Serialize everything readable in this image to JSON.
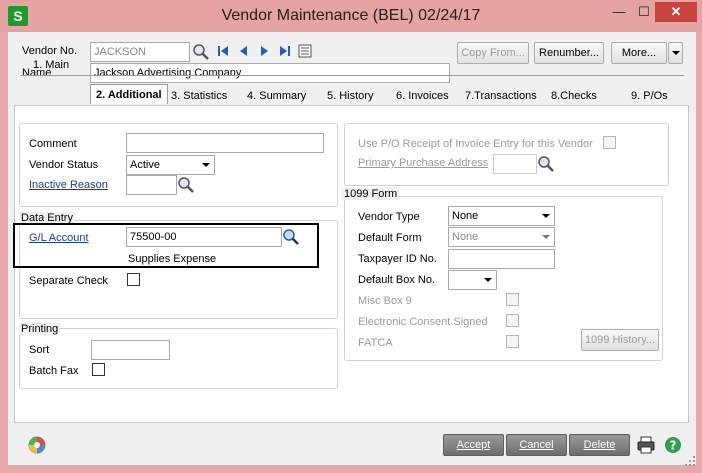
{
  "window": {
    "title": "Vendor Maintenance (BEL) 02/24/17",
    "app_icon_letter": "S",
    "minimize": "—",
    "maximize": "☐",
    "close": "✕"
  },
  "header": {
    "vendor_no_label": "Vendor No.",
    "vendor_no_value": "JACKSON",
    "name_label": "Name",
    "name_value": "Jackson Advertising Company",
    "copy_from": "Copy From...",
    "renumber": "Renumber...",
    "more": "More..."
  },
  "tabs": [
    {
      "label": "1. Main"
    },
    {
      "label": "2. Additional"
    },
    {
      "label": "3. Statistics"
    },
    {
      "label": "4. Summary"
    },
    {
      "label": "5. History"
    },
    {
      "label": "6. Invoices"
    },
    {
      "label": "7.Transactions"
    },
    {
      "label": "8.Checks"
    },
    {
      "label": "9. P/Os"
    }
  ],
  "general": {
    "comment_label": "Comment",
    "comment_value": "",
    "vendor_status_label": "Vendor Status",
    "vendor_status_value": "Active",
    "inactive_reason_label": "Inactive Reason",
    "inactive_reason_value": ""
  },
  "data_entry": {
    "title": "Data Entry",
    "gl_account_label": "G/L Account",
    "gl_account_value": "75500-00",
    "gl_account_desc": "Supplies Expense",
    "separate_check_label": "Separate Check"
  },
  "printing": {
    "title": "Printing",
    "sort_label": "Sort",
    "sort_value": "",
    "batch_fax_label": "Batch Fax"
  },
  "po": {
    "use_po_receipt_label": "Use P/O Receipt of Invoice Entry for this Vendor",
    "primary_purchase_label": "Primary Purchase Address"
  },
  "form1099": {
    "title": "1099 Form",
    "vendor_type_label": "Vendor Type",
    "vendor_type_value": "None",
    "default_form_label": "Default Form",
    "default_form_value": "None",
    "taxpayer_id_label": "Taxpayer ID No.",
    "taxpayer_id_value": "",
    "default_box_label": "Default Box No.",
    "default_box_value": "",
    "misc_box9_label": "Misc Box 9",
    "electronic_consent_label": "Electronic Consent Signed",
    "fatca_label": "FATCA",
    "history_button": "1099 History..."
  },
  "footer": {
    "accept": "Accept",
    "cancel": "Cancel",
    "delete": "Delete"
  }
}
